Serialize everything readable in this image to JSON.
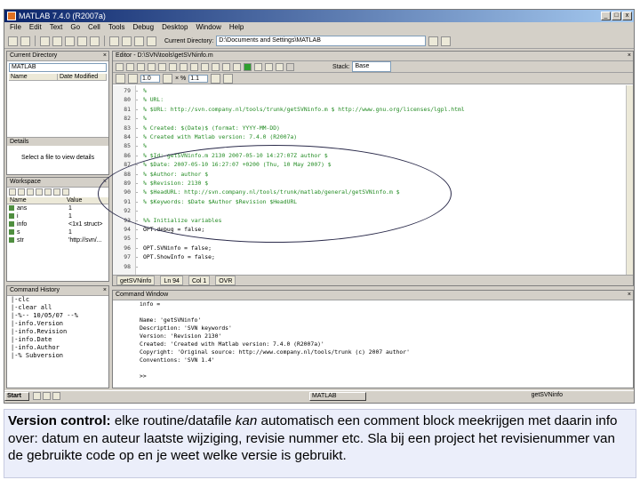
{
  "window": {
    "title": "MATLAB 7.4.0 (R2007a)",
    "buttons": [
      "_",
      "□",
      "x"
    ]
  },
  "menubar": [
    "File",
    "Edit",
    "Text",
    "Go",
    "Cell",
    "Tools",
    "Debug",
    "Desktop",
    "Window",
    "Help"
  ],
  "toolbar": {
    "current_dir_label": "Current Directory:",
    "current_dir_value": "D:\\Documents and Settings\\MATLAB"
  },
  "current_directory_pane": {
    "title": "Current Directory",
    "path": "MATLAB",
    "columns": [
      "Name",
      "Date Modified"
    ],
    "details_label": "Details",
    "details_text": "Select a file to view details"
  },
  "workspace_pane": {
    "title": "Workspace",
    "columns": [
      "Name",
      "Value"
    ],
    "rows": [
      {
        "name": "ans",
        "value": "1"
      },
      {
        "name": "i",
        "value": "1"
      },
      {
        "name": "info",
        "value": "<1x1 struct>"
      },
      {
        "name": "s",
        "value": "1"
      },
      {
        "name": "str",
        "value": "'http://svn/..."
      }
    ]
  },
  "command_history_pane": {
    "title": "Command History",
    "lines": [
      "|-clc",
      "|-clear all",
      "|-%-- 10/05/07 --%",
      "|-info.Version",
      "|-info.Revision",
      "|-info.Date",
      "|-info.Author",
      "|-% Subversion"
    ]
  },
  "editor": {
    "title": "Editor - D:\\SVN\\tools\\getSVNinfo.m",
    "cell_values": [
      "1.0",
      "1.1"
    ],
    "cell_label": "× %",
    "mode_label": "Base",
    "code_lines": [
      {
        "n": "79",
        "text": "%",
        "kind": "c"
      },
      {
        "n": "80",
        "text": "%   URL:",
        "kind": "c"
      },
      {
        "n": "81",
        "text": "%     $URL: http://svn.company.nl/tools/trunk/getSVNinfo.m $  http://www.gnu.org/licenses/lgpl.html",
        "kind": "c"
      },
      {
        "n": "82",
        "text": "%",
        "kind": "c"
      },
      {
        "n": "83",
        "text": "%   Created: $(Date)$ (format: YYYY-MM-DD)",
        "kind": "c"
      },
      {
        "n": "84",
        "text": "%   Created with Matlab version: 7.4.0 (R2007a)",
        "kind": "c"
      },
      {
        "n": "85",
        "text": "%",
        "kind": "c"
      },
      {
        "n": "86",
        "text": "%   $Id: getSVNinfo.m 2130 2007-05-10 14:27:07Z author $",
        "kind": "c"
      },
      {
        "n": "87",
        "text": "%   $Date: 2007-05-10 16:27:07 +0200 (Thu, 10 May 2007) $",
        "kind": "c"
      },
      {
        "n": "88",
        "text": "%   $Author: author $",
        "kind": "c"
      },
      {
        "n": "89",
        "text": "%   $Revision: 2130 $",
        "kind": "c"
      },
      {
        "n": "90",
        "text": "%   $HeadURL: http://svn.company.nl/tools/trunk/matlab/general/getSVNinfo.m $",
        "kind": "c"
      },
      {
        "n": "91",
        "text": "%   $Keywords: $Date $Author $Revision $HeadURL",
        "kind": "c"
      },
      {
        "n": "92",
        "text": "",
        "kind": "k"
      },
      {
        "n": "93",
        "text": "%% Initialize variables",
        "kind": "c"
      },
      {
        "n": "94",
        "text": "OPT.debug = false;",
        "kind": "k"
      },
      {
        "n": "95",
        "text": "",
        "kind": "k"
      },
      {
        "n": "96",
        "text": "OPT.SVNinfo = false;",
        "kind": "k"
      },
      {
        "n": "97",
        "text": "OPT.ShowInfo = false;",
        "kind": "k"
      },
      {
        "n": "98",
        "text": "",
        "kind": "k"
      }
    ],
    "status_items": [
      "getSVNinfo",
      "Ln 94",
      "Col 1",
      "OVR"
    ]
  },
  "command_window": {
    "title": "Command Window",
    "lines": [
      "info =",
      "",
      "          Name: 'getSVNinfo'",
      "   Description: 'SVN keywords'",
      "       Version: 'Revision 2130'",
      "       Created: 'Created with Matlab version: 7.4.0 (R2007a)'",
      "     Copyright: 'Original source: http://www.company.nl/tools/trunk  (c) 2007 author'",
      "   Conventions: 'SVN 1.4'",
      "",
      ">>"
    ]
  },
  "taskbar": {
    "start_label": "Start",
    "status_text": "getSVNinfo",
    "task_label": "MATLAB"
  },
  "caption": {
    "bold_lead": "Version control:",
    "text_1": " elke routine/datafile ",
    "italic_word": "kan",
    "text_2": " automatisch een comment block meekrijgen met daarin info over: datum en auteur laatste wijziging, revisie nummer etc. Sla bij een project het revisienummer van de gebruikte code op en je weet welke versie is gebruikt."
  }
}
